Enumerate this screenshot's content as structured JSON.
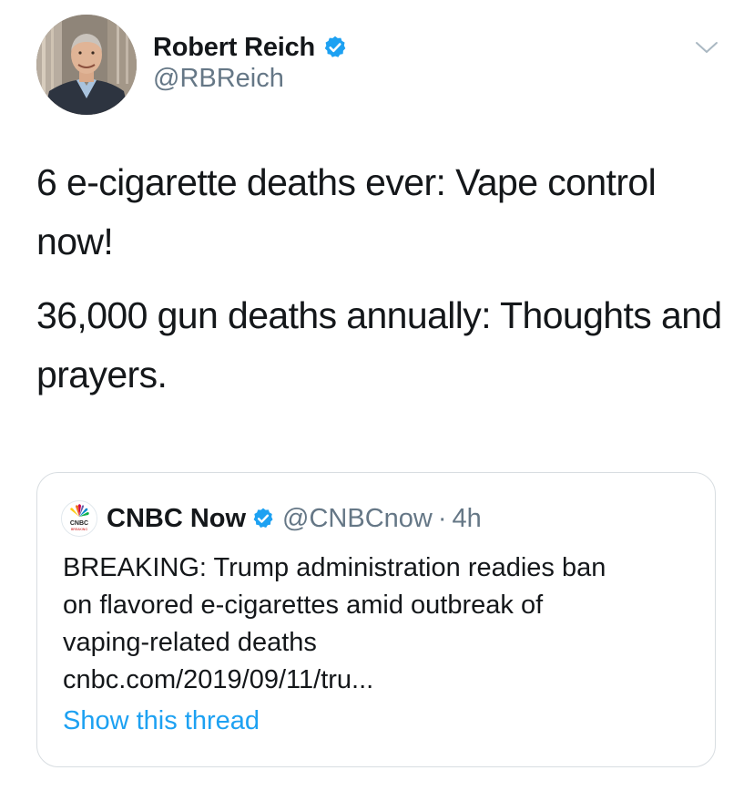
{
  "tweet": {
    "author": {
      "display_name": "Robert Reich",
      "handle": "@RBReich",
      "verified": true,
      "avatar_icon": "user-avatar-photo"
    },
    "menu_icon": "chevron-down-icon",
    "paragraphs": [
      "6 e-cigarette deaths ever: Vape control now!",
      "36,000 gun deaths annually: Thoughts and prayers."
    ]
  },
  "quoted_tweet": {
    "author": {
      "display_name": "CNBC Now",
      "handle": "@CNBCnow",
      "verified": true,
      "avatar_icon": "cnbc-logo-icon"
    },
    "separator": "·",
    "time": "4h",
    "body_lines": [
      "BREAKING: Trump administration readies ban",
      "on flavored e-cigarettes amid outbreak of",
      "vaping-related deaths",
      "cnbc.com/2019/09/11/tru..."
    ],
    "show_thread_label": "Show this thread"
  },
  "colors": {
    "text_primary": "#14171a",
    "text_secondary": "#657786",
    "accent": "#1da1f2",
    "border": "#d8dde1"
  }
}
